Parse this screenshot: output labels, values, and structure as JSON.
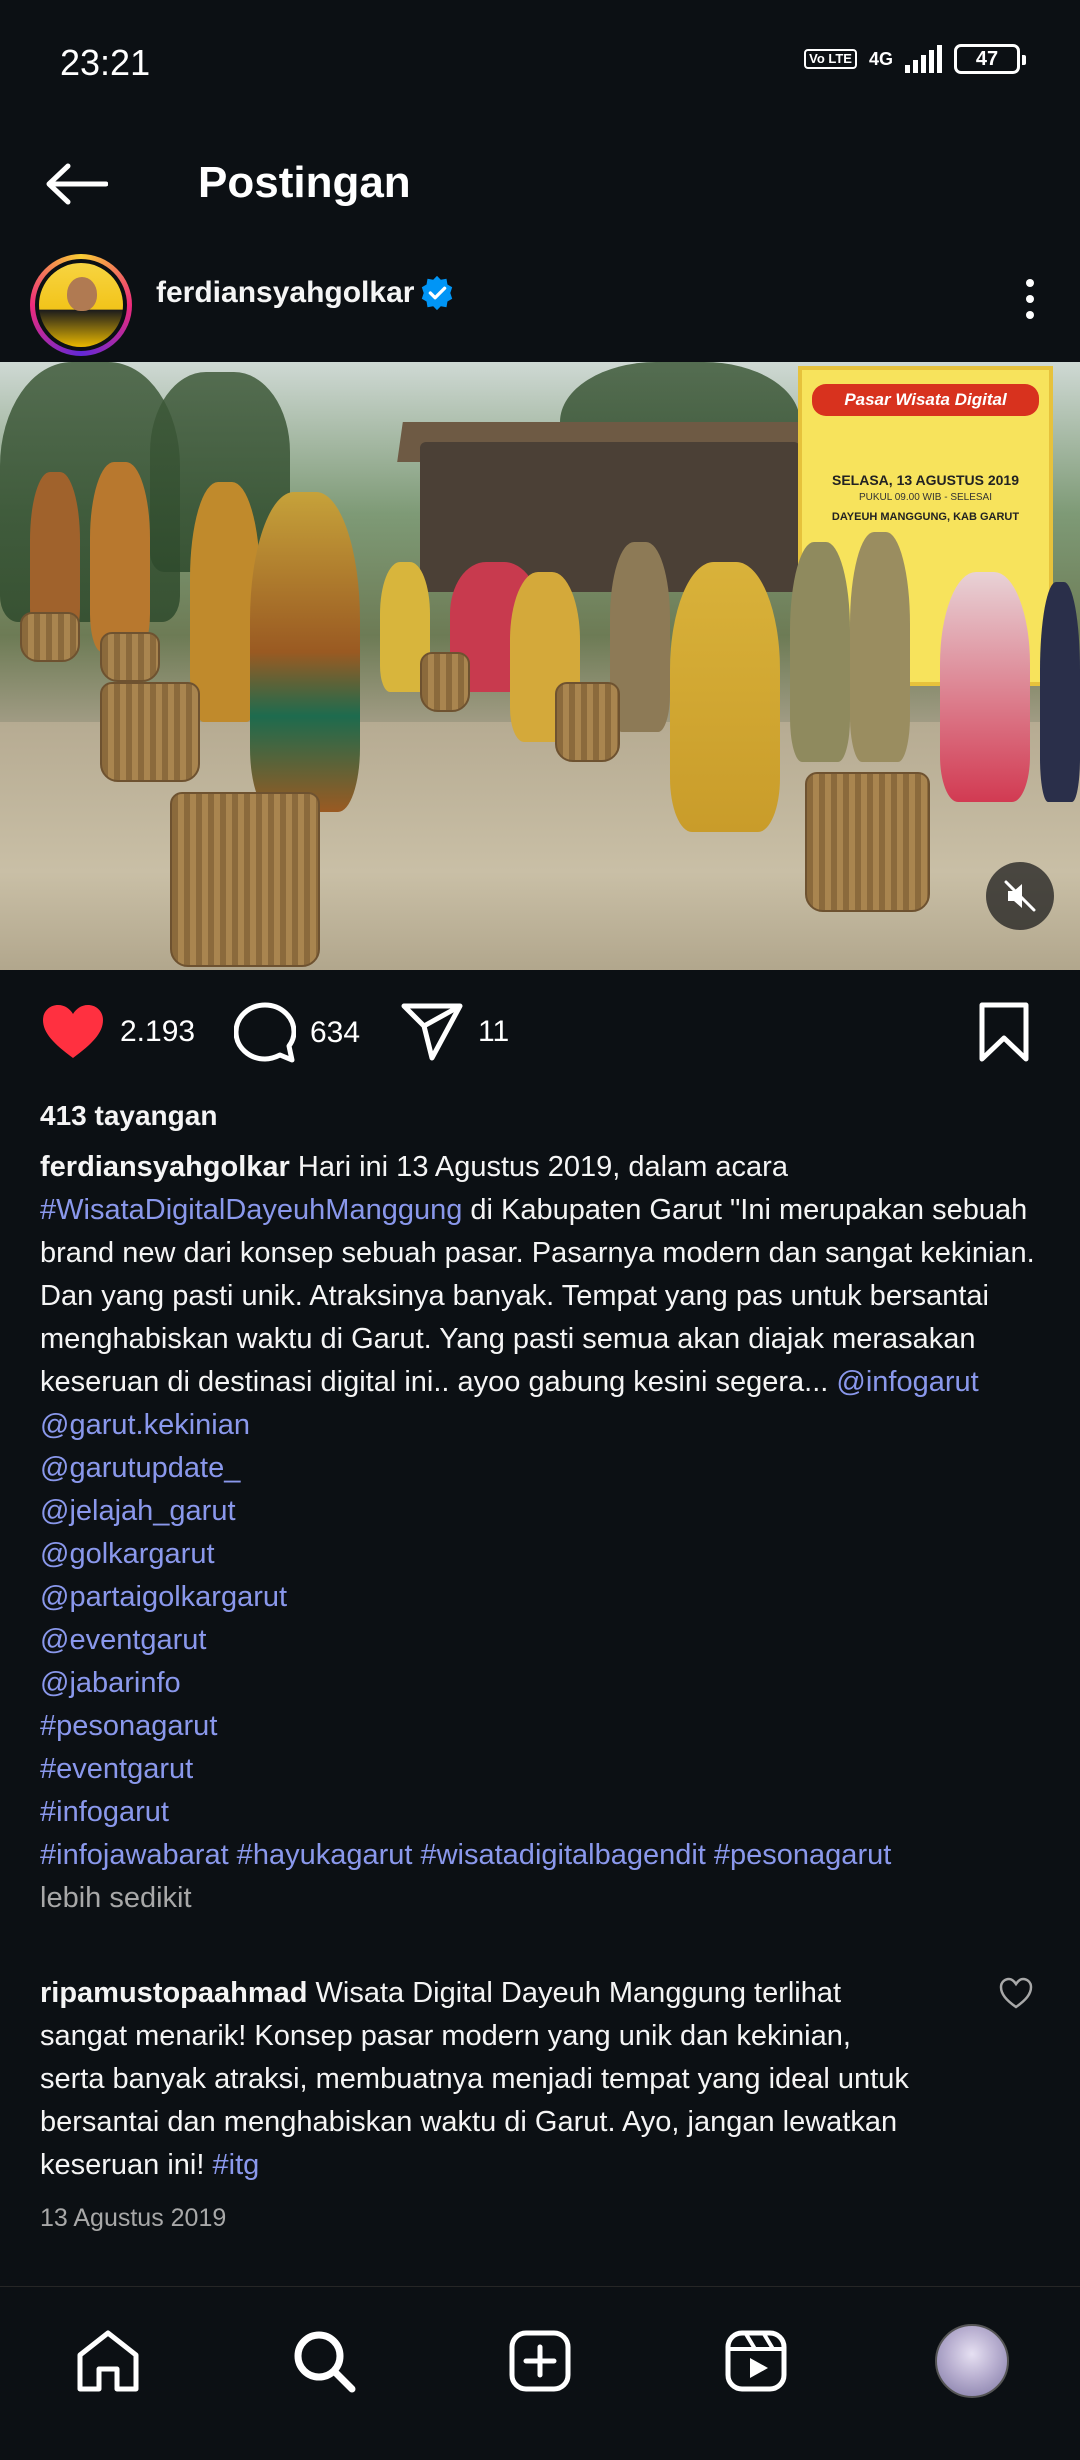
{
  "status_bar": {
    "time": "23:21",
    "volte_label": "Vo LTE",
    "network": "4G",
    "battery": "47"
  },
  "header": {
    "title": "Postingan",
    "back_icon": "arrow-left-icon"
  },
  "post": {
    "author": "ferdiansyahgolkar",
    "verified": true,
    "media": {
      "banner_title": "Pasar Wisata Digital",
      "banner_date": "SELASA, 13 AGUSTUS 2019",
      "banner_time": "PUKUL 09.00 WIB - SELESAI",
      "banner_place": "DAYEUH MANGGUNG, KAB GARUT",
      "muted": true
    },
    "actions": {
      "likes": "2.193",
      "comments": "634",
      "shares": "11"
    },
    "views": "413 tayangan",
    "caption": {
      "username": "ferdiansyahgolkar",
      "text_1": " Hari ini 13 Agustus 2019, dalam acara ",
      "hashtag_1": "#WisataDigitalDayeuhManggung",
      "text_2": " di Kabupaten Garut \"Ini merupakan sebuah brand new dari konsep sebuah pasar. Pasarnya modern dan sangat kekinian. Dan yang pasti unik. Atraksinya banyak. Tempat yang pas untuk bersantai menghabiskan waktu di Garut. Yang pasti semua akan diajak merasakan keseruan di destinasi digital ini.. ayoo gabung kesini segera... ",
      "mention_1": "@infogarut",
      "tag_lines": [
        "@garut.kekinian",
        "@garutupdate_",
        "@jelajah_garut",
        "@golkargarut",
        "@partaigolkargarut",
        "@eventgarut",
        "@jabarinfo",
        "#pesonagarut",
        "#eventgarut",
        "#infogarut",
        "#infojawabarat #hayukagarut #wisatadigitalbagendit #pesonagarut"
      ],
      "less_label": "lebih sedikit"
    },
    "comment": {
      "username": "ripamustopaahmad",
      "text": " Wisata Digital Dayeuh Manggung terlihat sangat menarik! Konsep pasar modern yang unik dan kekinian, serta banyak atraksi, membuatnya menjadi tempat yang ideal untuk bersantai dan menghabiskan waktu di Garut. Ayo, jangan lewatkan keseruan ini! ",
      "hashtag": "#itg"
    },
    "date": "13 Agustus 2019"
  },
  "bottom_nav": {
    "items": [
      "home-icon",
      "search-icon",
      "create-icon",
      "reels-icon",
      "profile-avatar"
    ]
  },
  "colors": {
    "background": "#0c1014",
    "like_red": "#ff3040",
    "link_blue": "#8a98ec",
    "verified_blue": "#0095f6",
    "muted_text": "#a8a8a8"
  }
}
